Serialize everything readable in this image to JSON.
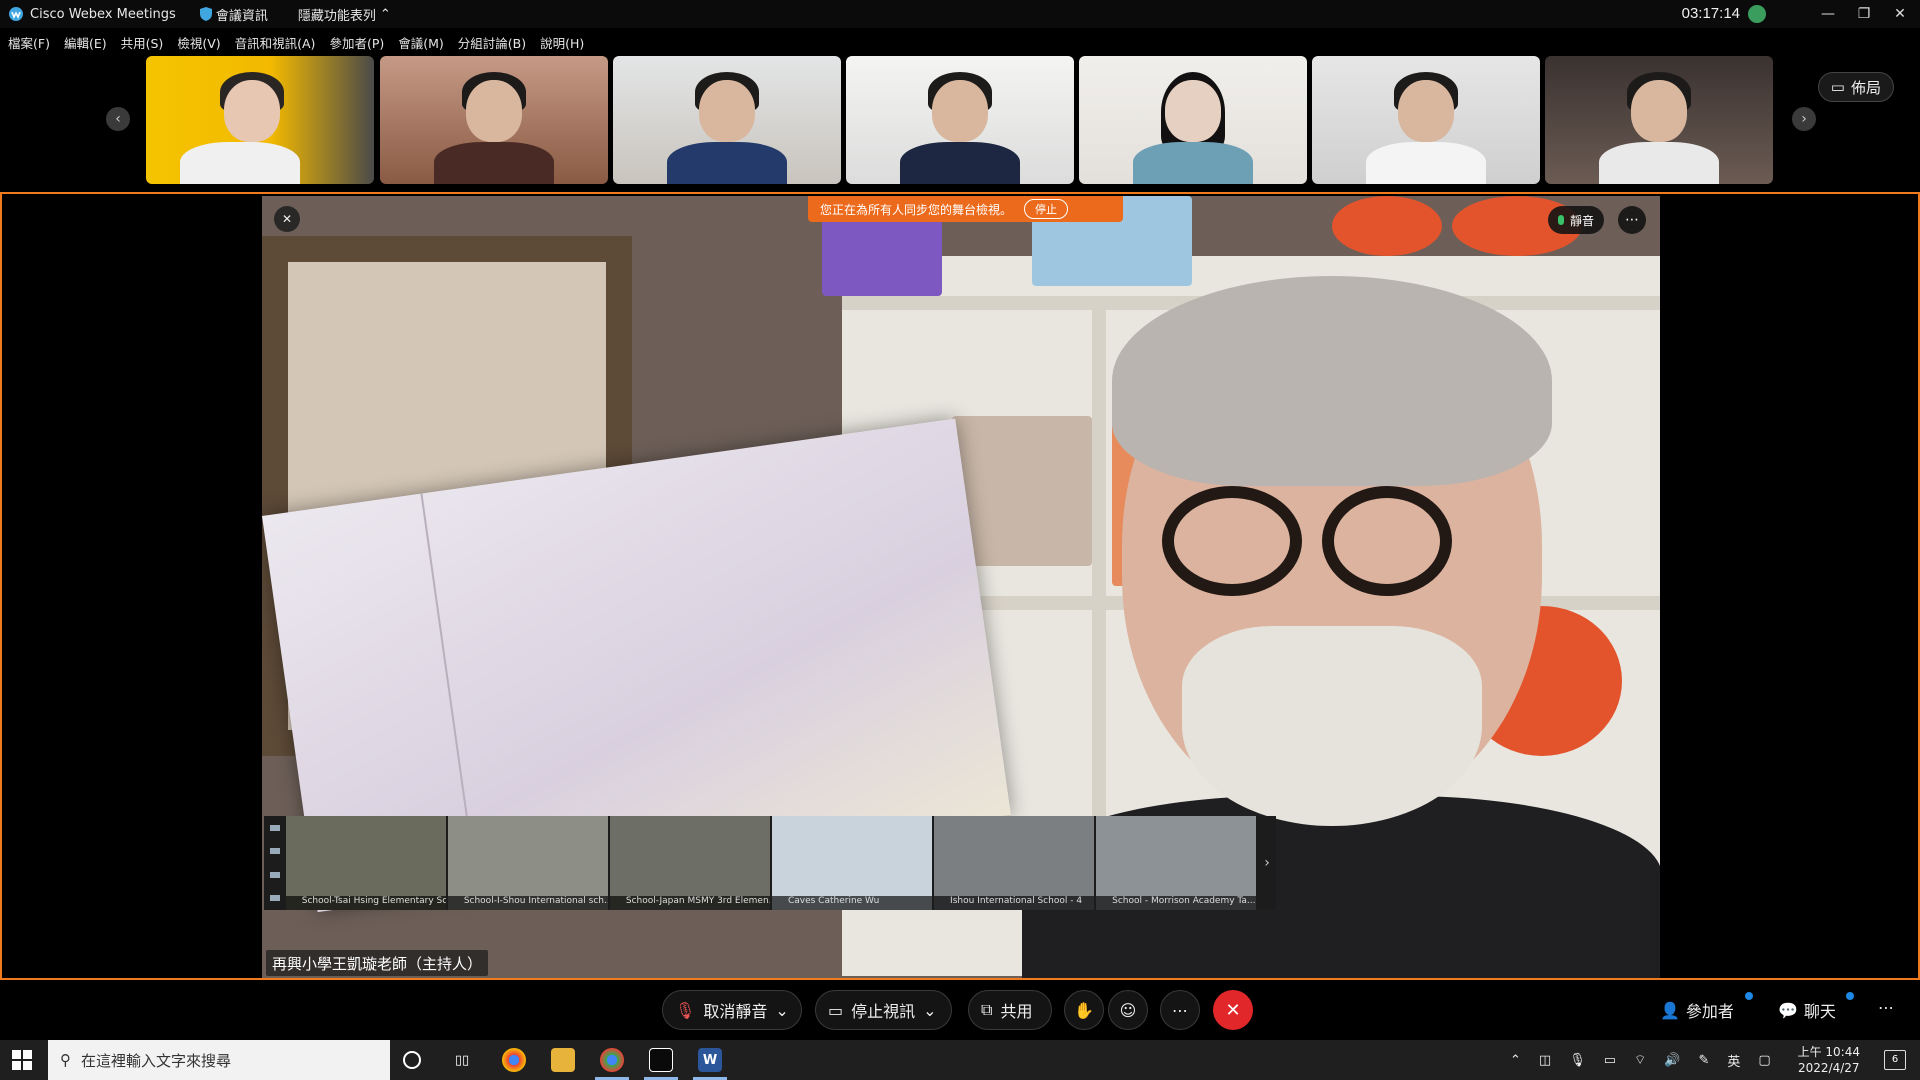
{
  "titlebar": {
    "app_title": "Cisco Webex Meetings",
    "meeting_info": "會議資訊",
    "hide_bar": "隱藏功能表列",
    "clock": "03:17:14"
  },
  "menu": [
    "檔案(F)",
    "編輯(E)",
    "共用(S)",
    "檢視(V)",
    "音訊和視訊(A)",
    "參加者(P)",
    "會議(M)",
    "分組討論(B)",
    "說明(H)"
  ],
  "filmstrip": {
    "layout_label": "佈局"
  },
  "stage": {
    "sync_banner": "您正在為所有人同步您的舞台檢視。",
    "stop_label": "停止",
    "mute_label": "靜音",
    "host_label": "再興小學王凱璇老師（主持人）",
    "sub_thumbs": [
      "School-Tsai Hsing Elementary Sc...",
      "School-I-Shou International sch...",
      "School-Japan MSMY 3rd Elemen...",
      "Caves Catherine Wu",
      "Ishou International School - 4",
      "School - Morrison Academy Ta..."
    ]
  },
  "controls": {
    "unmute": "取消靜音",
    "stop_video": "停止視訊",
    "share": "共用",
    "participants": "參加者",
    "chat": "聊天"
  },
  "taskbar": {
    "search_placeholder": "在這裡輸入文字來搜尋",
    "ime": "英",
    "time": "上午 10:44",
    "date": "2022/4/27",
    "notifications": "6"
  },
  "colors": {
    "accent_orange": "#f07a1c",
    "leave_red": "#e2272a",
    "mic_green": "#39c26a"
  }
}
